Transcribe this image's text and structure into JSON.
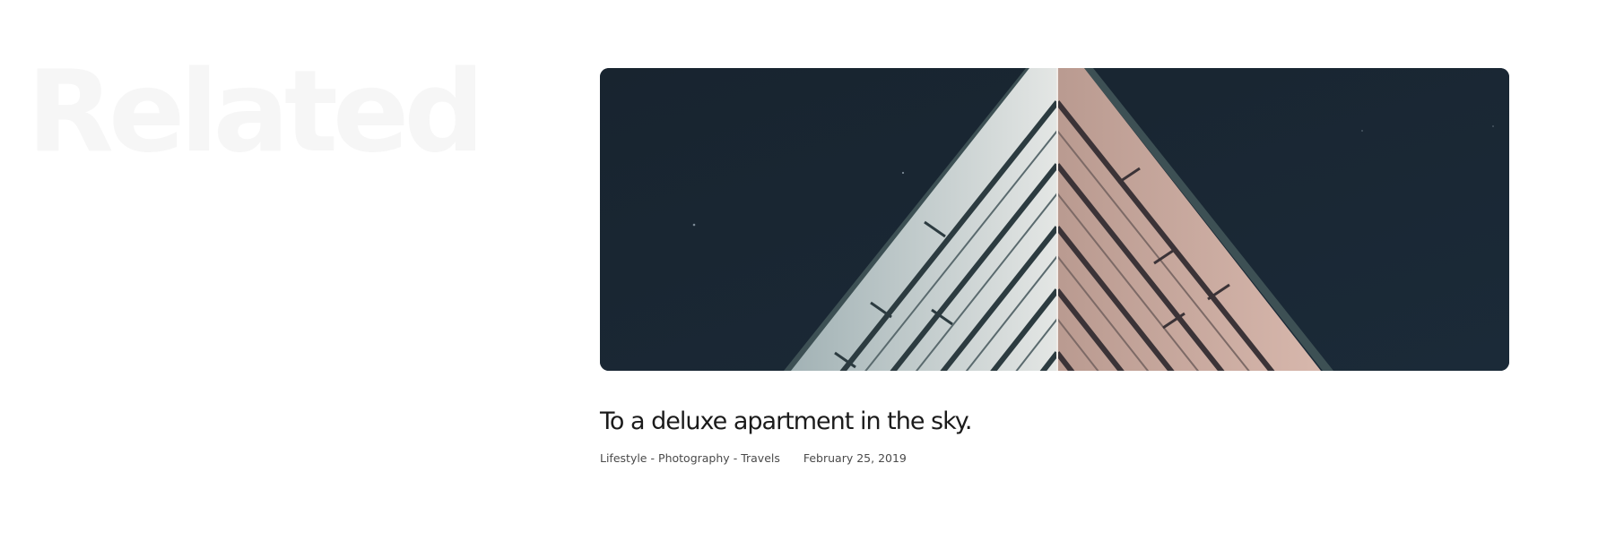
{
  "section": {
    "heading": "Related"
  },
  "post": {
    "title": "To a deluxe apartment in the sky.",
    "categories": [
      "Lifestyle",
      "Photography",
      "Travels"
    ],
    "separator": "-",
    "date": "February 25, 2019"
  },
  "colors": {
    "heading": "#f6f6f6",
    "image_sky": "#1a2634",
    "title": "#1b1b1b",
    "meta": "#4a4a4a"
  }
}
